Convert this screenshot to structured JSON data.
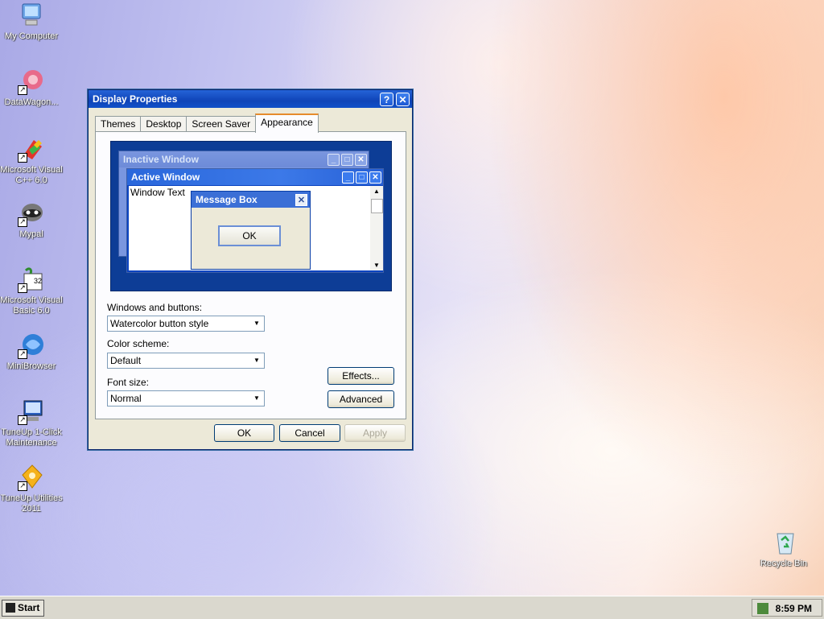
{
  "desktop": {
    "icons": [
      {
        "label": "My Computer"
      },
      {
        "label": "DataWagon..."
      },
      {
        "label": "Microsoft Visual C++ 6.0"
      },
      {
        "label": "Mypal"
      },
      {
        "label": "Microsoft Visual Basic 6.0"
      },
      {
        "label": "MiniBrowser"
      },
      {
        "label": "TuneUp 1-Click Maintenance"
      },
      {
        "label": "TuneUp Utilities 2011"
      },
      {
        "label": "Recycle Bin"
      }
    ]
  },
  "dialog": {
    "title": "Display Properties",
    "help_glyph": "?",
    "close_glyph": "✕",
    "tabs": [
      {
        "label": "Themes"
      },
      {
        "label": "Desktop"
      },
      {
        "label": "Screen Saver"
      },
      {
        "label": "Appearance",
        "active": true
      }
    ],
    "preview": {
      "inactive_title": "Inactive Window",
      "active_title": "Active Window",
      "window_text": "Window Text",
      "msgbox_title": "Message Box",
      "msgbox_ok": "OK"
    },
    "windows_buttons": {
      "label": "Windows and buttons:",
      "value": "Watercolor button style"
    },
    "color_scheme": {
      "label": "Color scheme:",
      "value": "Default"
    },
    "font_size": {
      "label": "Font size:",
      "value": "Normal"
    },
    "effects_button": "Effects...",
    "advanced_button": "Advanced",
    "ok_button": "OK",
    "cancel_button": "Cancel",
    "apply_button": "Apply"
  },
  "taskbar": {
    "start_label": "Start",
    "clock": "8:59 PM"
  },
  "colors": {
    "title_bar": "#0f44b8",
    "dialog_bg": "#ece9d8",
    "preview_bg": "#0d3d96"
  }
}
